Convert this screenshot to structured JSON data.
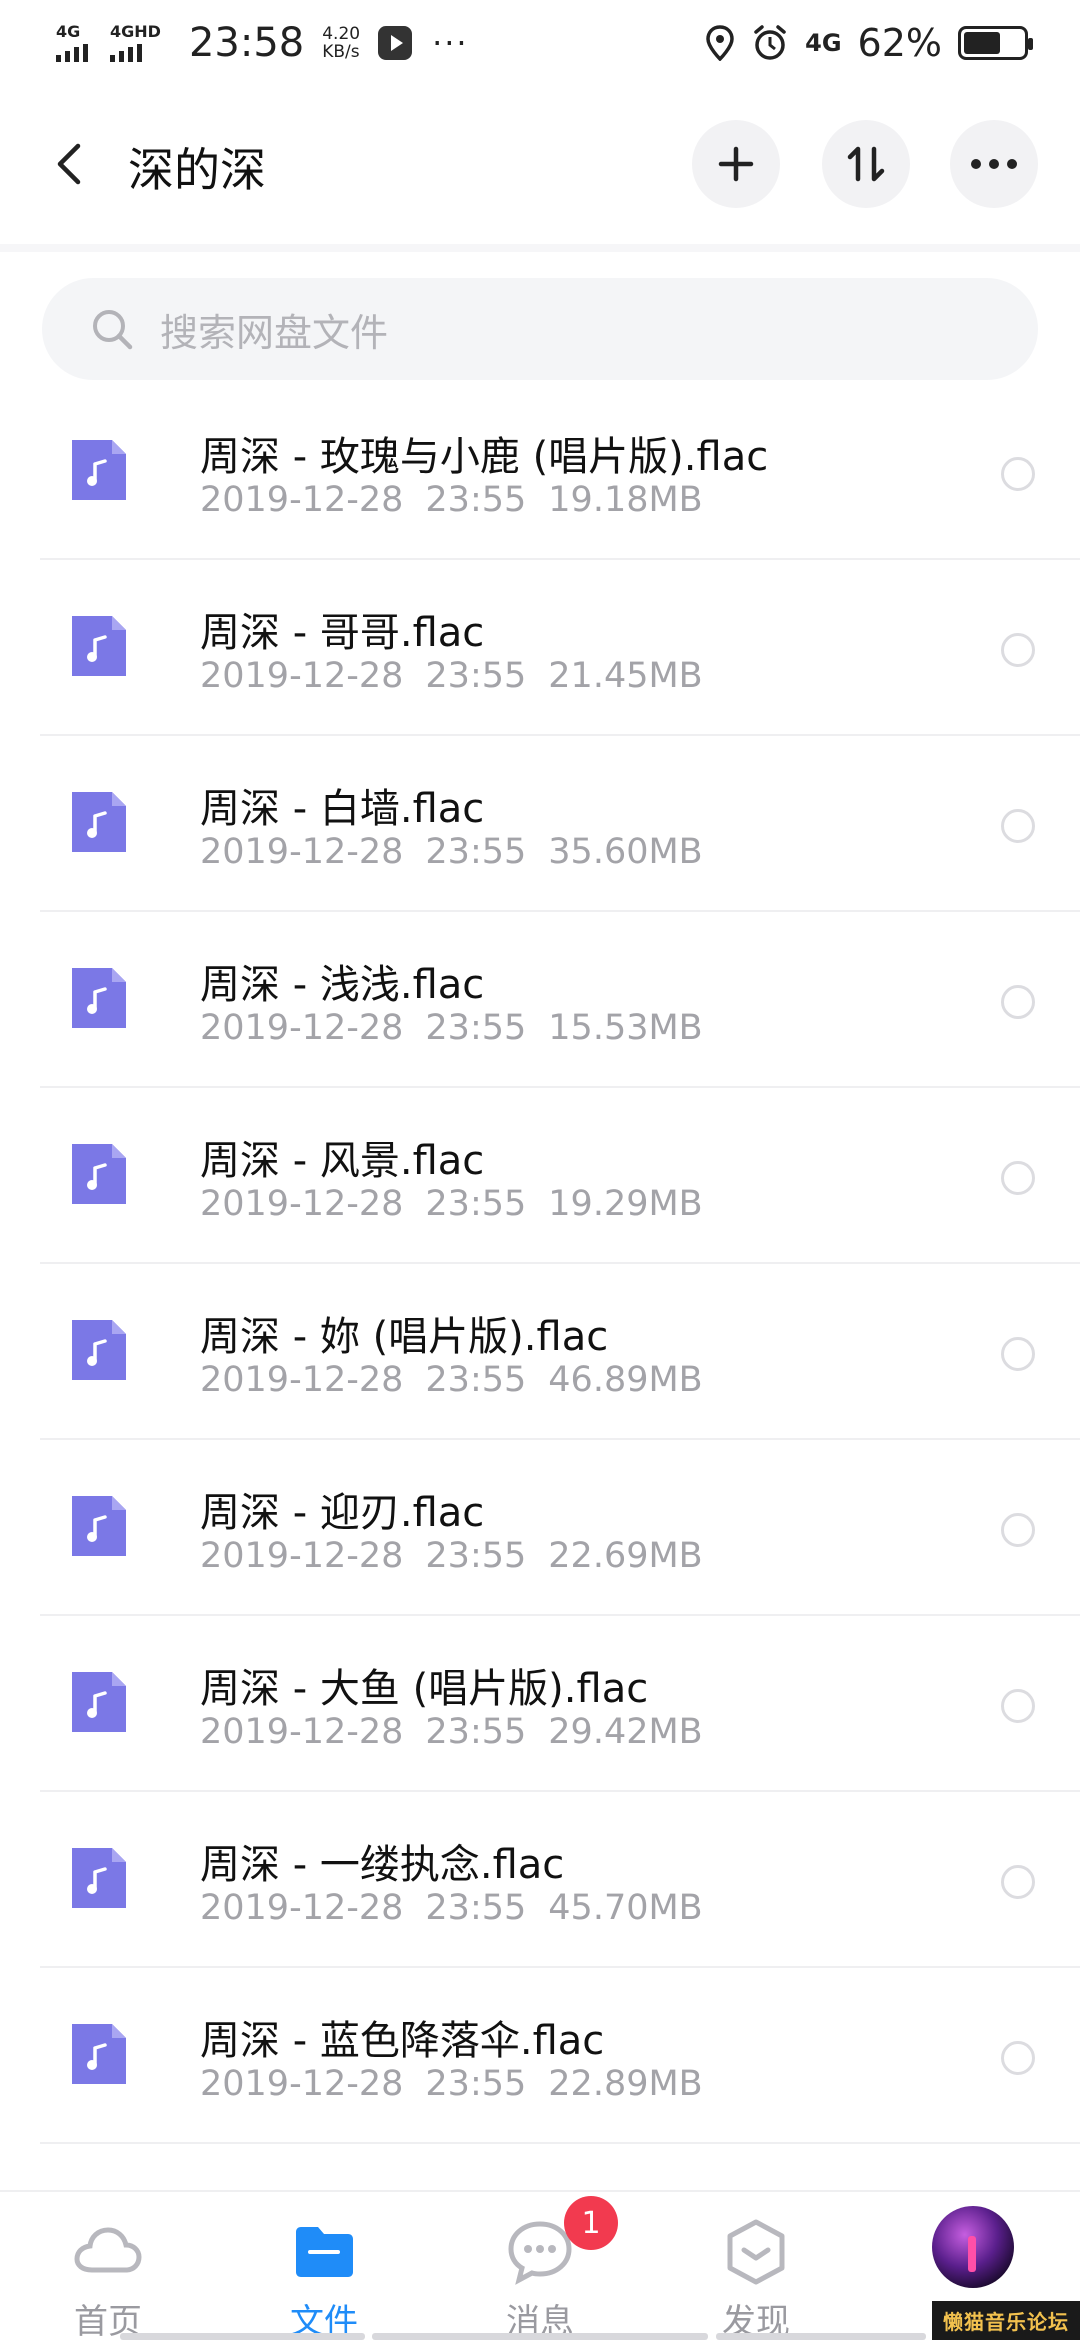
{
  "status_bar": {
    "signal1": "4G",
    "signal2": "4GHD",
    "time": "23:58",
    "speed_value": "4.20",
    "speed_unit": "KB/s",
    "more": "···",
    "net_right": "4G",
    "battery_text": "62%",
    "battery_level": 0.62
  },
  "header": {
    "title": "深的深",
    "back_icon": "chevron-left-icon",
    "add_icon": "plus-icon",
    "sort_icon": "sort-icon",
    "more_icon": "more-horizontal-icon"
  },
  "search": {
    "placeholder": "搜索网盘文件",
    "icon": "search-icon"
  },
  "files": [
    {
      "name": "周深 - 玫瑰与小鹿 (唱片版).flac",
      "date": "2019-12-28",
      "time": "23:55",
      "size": "19.18MB"
    },
    {
      "name": "周深 - 哥哥.flac",
      "date": "2019-12-28",
      "time": "23:55",
      "size": "21.45MB"
    },
    {
      "name": "周深 - 白墙.flac",
      "date": "2019-12-28",
      "time": "23:55",
      "size": "35.60MB"
    },
    {
      "name": "周深 - 浅浅.flac",
      "date": "2019-12-28",
      "time": "23:55",
      "size": "15.53MB"
    },
    {
      "name": "周深 - 风景.flac",
      "date": "2019-12-28",
      "time": "23:55",
      "size": "19.29MB"
    },
    {
      "name": "周深 - 妳 (唱片版).flac",
      "date": "2019-12-28",
      "time": "23:55",
      "size": "46.89MB"
    },
    {
      "name": "周深 - 迎刃.flac",
      "date": "2019-12-28",
      "time": "23:55",
      "size": "22.69MB"
    },
    {
      "name": "周深 - 大鱼 (唱片版).flac",
      "date": "2019-12-28",
      "time": "23:55",
      "size": "29.42MB"
    },
    {
      "name": "周深 - 一缕执念.flac",
      "date": "2019-12-28",
      "time": "23:55",
      "size": "45.70MB"
    },
    {
      "name": "周深 - 蓝色降落伞.flac",
      "date": "2019-12-28",
      "time": "23:55",
      "size": "22.89MB"
    }
  ],
  "bottom_nav": {
    "tabs": [
      {
        "label": "首页",
        "icon": "cloud-icon"
      },
      {
        "label": "文件",
        "icon": "folder-icon",
        "active": true
      },
      {
        "label": "消息",
        "icon": "chat-bubble-icon"
      },
      {
        "label": "发现",
        "icon": "discover-icon"
      }
    ],
    "message_badge": "1"
  },
  "watermark": "懒猫音乐论坛",
  "colors": {
    "accent": "#1f8cf8",
    "file_icon": "#7b78e6",
    "badge": "#f23a4f"
  }
}
